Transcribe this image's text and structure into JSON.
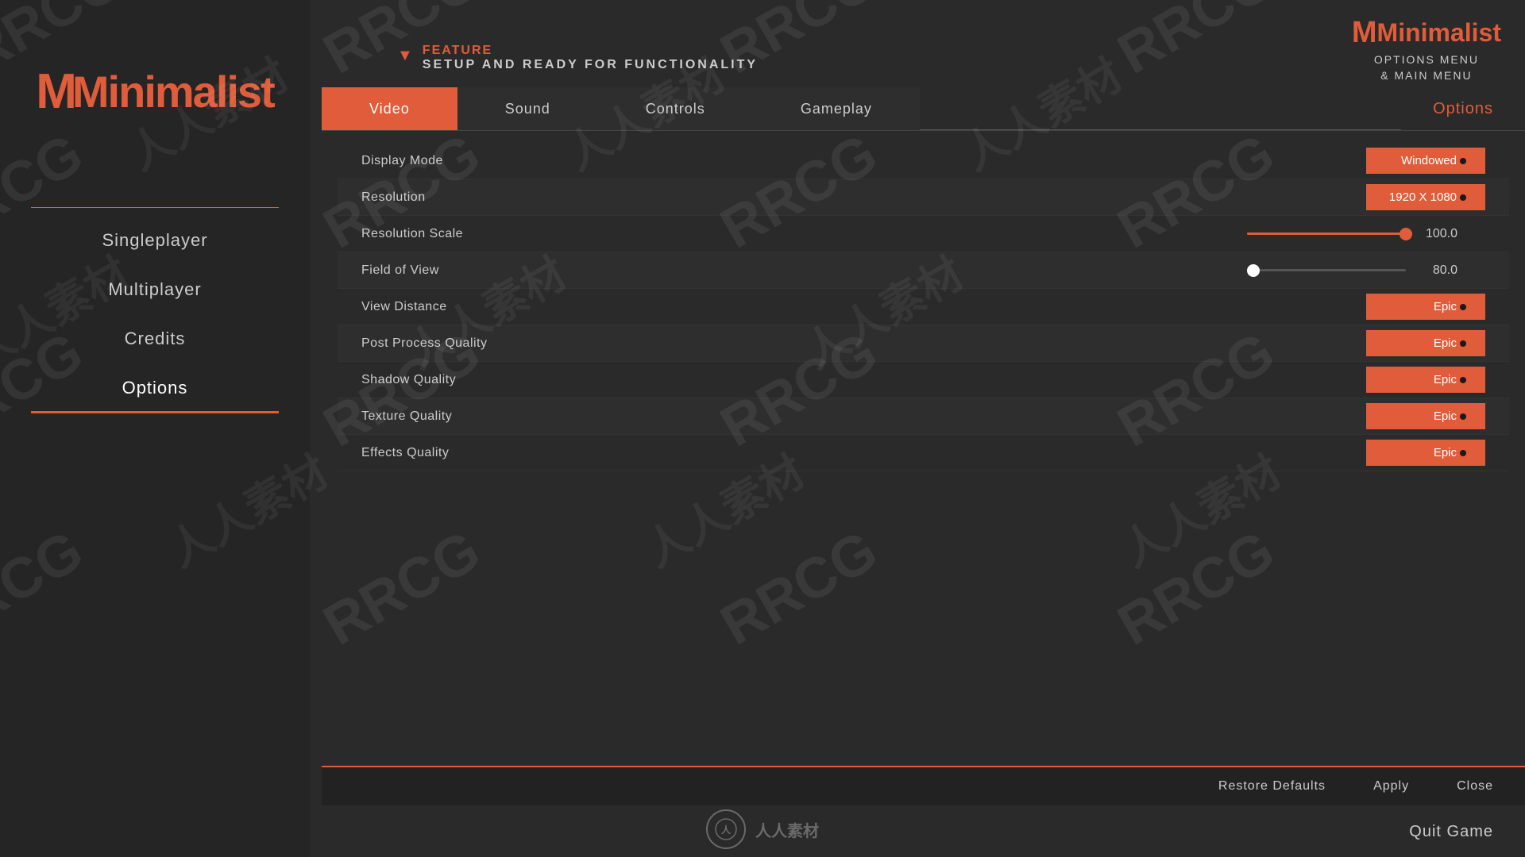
{
  "brand": {
    "logo": "Minimalist",
    "top_right_logo": "Minimalist",
    "top_right_line1": "OPTIONS MENU",
    "top_right_line2": "& MAIN MENU"
  },
  "feature": {
    "label": "FEATURE",
    "description": "SETUP AND READY FOR FUNCTIONALITY"
  },
  "tabs": [
    {
      "id": "video",
      "label": "Video",
      "active": true
    },
    {
      "id": "sound",
      "label": "Sound",
      "active": false
    },
    {
      "id": "controls",
      "label": "Controls",
      "active": false
    },
    {
      "id": "gameplay",
      "label": "Gameplay",
      "active": false
    }
  ],
  "tabs_options_label": "Options",
  "nav": {
    "items": [
      {
        "id": "singleplayer",
        "label": "Singleplayer"
      },
      {
        "id": "multiplayer",
        "label": "Multiplayer"
      },
      {
        "id": "credits",
        "label": "Credits"
      },
      {
        "id": "options",
        "label": "Options",
        "active": true
      }
    ]
  },
  "settings": {
    "rows": [
      {
        "id": "display-mode",
        "label": "Display Mode",
        "type": "button",
        "value": "Windowed",
        "dot": true
      },
      {
        "id": "resolution",
        "label": "Resolution",
        "type": "button",
        "value": "1920 X 1080",
        "dot": true
      },
      {
        "id": "resolution-scale",
        "label": "Resolution Scale",
        "type": "slider",
        "value": 100.0,
        "fill_pct": 100,
        "thumb_pct": 100
      },
      {
        "id": "field-of-view",
        "label": "Field of View",
        "type": "slider",
        "value": 80.0,
        "fill_pct": 0,
        "thumb_pct": 0,
        "white_thumb": true
      },
      {
        "id": "view-distance",
        "label": "View Distance",
        "type": "button",
        "value": "Epic",
        "dot": true
      },
      {
        "id": "post-process-quality",
        "label": "Post Process Quality",
        "type": "button",
        "value": "Epic",
        "dot": true
      },
      {
        "id": "shadow-quality",
        "label": "Shadow Quality",
        "type": "button",
        "value": "Epic",
        "dot": true
      },
      {
        "id": "texture-quality",
        "label": "Texture Quality",
        "type": "button",
        "value": "Epic",
        "dot": true
      },
      {
        "id": "effects-quality",
        "label": "Effects Quality",
        "type": "button",
        "value": "Epic",
        "dot": true
      }
    ]
  },
  "bottom_bar": {
    "restore_defaults": "Restore Defaults",
    "apply": "Apply",
    "close": "Close"
  },
  "quit_game": "Quit Game",
  "watermarks": {
    "rrcg": "RRCG",
    "cn_text": "人人素材"
  }
}
